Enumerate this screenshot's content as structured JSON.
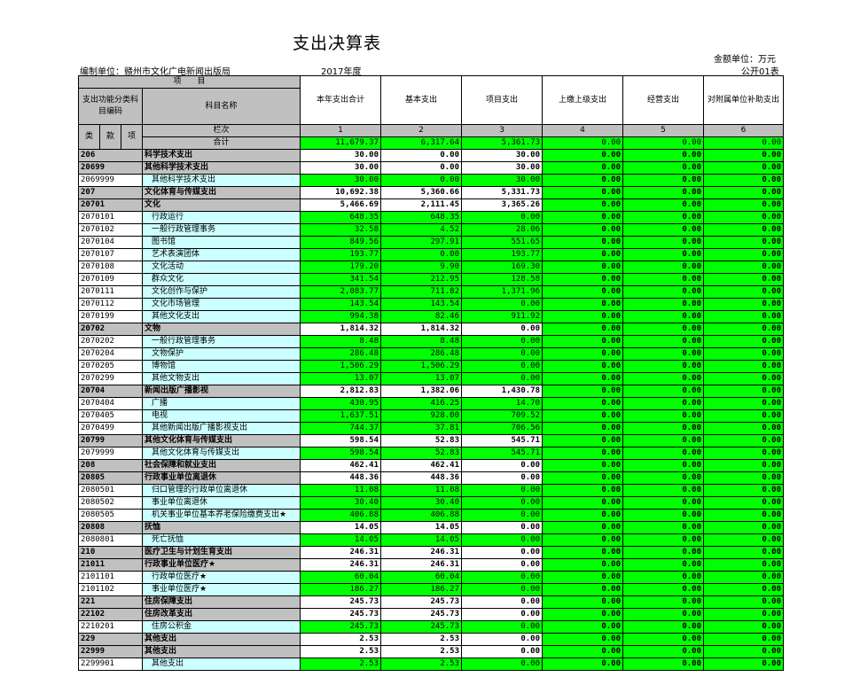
{
  "title": "支出决算表",
  "unit_label": "金额单位：万元",
  "org_label": "编制单位：赣州市文化广电新闻出版局",
  "year_label": "2017年度",
  "form_no": "公开01表",
  "header": {
    "item": "项　　目",
    "code_col": "支出功能分类科目编码",
    "name_col": "科目名称",
    "cols": [
      "本年支出合计",
      "基本支出",
      "项目支出",
      "上缴上级支出",
      "经营支出",
      "对附属单位补助支出"
    ],
    "lei": "类",
    "kuan": "款",
    "xiang": "项",
    "lanci": "栏次",
    "col_nums": [
      "1",
      "2",
      "3",
      "4",
      "5",
      "6"
    ],
    "total_label": "合计",
    "total_values": [
      "11,679.37",
      "6,317.64",
      "5,361.73",
      "0.00",
      "0.00",
      "0.00"
    ]
  },
  "rows": [
    {
      "code": "206",
      "name": "科学技术支出",
      "level": 1,
      "v": [
        "30.00",
        "0.00",
        "30.00",
        "0.00",
        "0.00",
        "0.00"
      ]
    },
    {
      "code": "20699",
      "name": "其他科学技术支出",
      "level": 2,
      "v": [
        "30.00",
        "0.00",
        "30.00",
        "0.00",
        "0.00",
        "0.00"
      ]
    },
    {
      "code": "2069999",
      "name": "其他科学技术支出",
      "level": 3,
      "v": [
        "30.00",
        "0.00",
        "30.00",
        "0.00",
        "0.00",
        "0.00"
      ]
    },
    {
      "code": "207",
      "name": "文化体育与传媒支出",
      "level": 1,
      "v": [
        "10,692.38",
        "5,360.66",
        "5,331.73",
        "0.00",
        "0.00",
        "0.00"
      ]
    },
    {
      "code": "20701",
      "name": "文化",
      "level": 2,
      "v": [
        "5,466.69",
        "2,111.45",
        "3,365.26",
        "0.00",
        "0.00",
        "0.00"
      ]
    },
    {
      "code": "2070101",
      "name": "行政运行",
      "level": 3,
      "v": [
        "648.35",
        "648.35",
        "0.00",
        "0.00",
        "0.00",
        "0.00"
      ]
    },
    {
      "code": "2070102",
      "name": "一般行政管理事务",
      "level": 3,
      "v": [
        "32.58",
        "4.52",
        "28.06",
        "0.00",
        "0.00",
        "0.00"
      ]
    },
    {
      "code": "2070104",
      "name": "图书馆",
      "level": 3,
      "v": [
        "849.56",
        "297.91",
        "551.65",
        "0.00",
        "0.00",
        "0.00"
      ]
    },
    {
      "code": "2070107",
      "name": "艺术表演团体",
      "level": 3,
      "v": [
        "193.77",
        "0.00",
        "193.77",
        "0.00",
        "0.00",
        "0.00"
      ]
    },
    {
      "code": "2070108",
      "name": "文化活动",
      "level": 3,
      "v": [
        "179.20",
        "9.90",
        "169.30",
        "0.00",
        "0.00",
        "0.00"
      ]
    },
    {
      "code": "2070109",
      "name": "群众文化",
      "level": 3,
      "v": [
        "341.54",
        "212.95",
        "128.58",
        "0.00",
        "0.00",
        "0.00"
      ]
    },
    {
      "code": "2070111",
      "name": "文化创作与保护",
      "level": 3,
      "v": [
        "2,083.77",
        "711.82",
        "1,371.96",
        "0.00",
        "0.00",
        "0.00"
      ]
    },
    {
      "code": "2070112",
      "name": "文化市场管理",
      "level": 3,
      "v": [
        "143.54",
        "143.54",
        "0.00",
        "0.00",
        "0.00",
        "0.00"
      ]
    },
    {
      "code": "2070199",
      "name": "其他文化支出",
      "level": 3,
      "v": [
        "994.38",
        "82.46",
        "911.92",
        "0.00",
        "0.00",
        "0.00"
      ]
    },
    {
      "code": "20702",
      "name": "文物",
      "level": 2,
      "v": [
        "1,814.32",
        "1,814.32",
        "0.00",
        "0.00",
        "0.00",
        "0.00"
      ]
    },
    {
      "code": "2070202",
      "name": "一般行政管理事务",
      "level": 3,
      "v": [
        "8.48",
        "8.48",
        "0.00",
        "0.00",
        "0.00",
        "0.00"
      ]
    },
    {
      "code": "2070204",
      "name": "文物保护",
      "level": 3,
      "v": [
        "286.48",
        "286.48",
        "0.00",
        "0.00",
        "0.00",
        "0.00"
      ]
    },
    {
      "code": "2070205",
      "name": "博物馆",
      "level": 3,
      "v": [
        "1,506.29",
        "1,506.29",
        "0.00",
        "0.00",
        "0.00",
        "0.00"
      ]
    },
    {
      "code": "2070299",
      "name": "其他文物支出",
      "level": 3,
      "v": [
        "13.07",
        "13.07",
        "0.00",
        "0.00",
        "0.00",
        "0.00"
      ]
    },
    {
      "code": "20704",
      "name": "新闻出版广播影视",
      "level": 2,
      "v": [
        "2,812.83",
        "1,382.06",
        "1,430.78",
        "0.00",
        "0.00",
        "0.00"
      ]
    },
    {
      "code": "2070404",
      "name": "广播",
      "level": 3,
      "v": [
        "430.95",
        "416.25",
        "14.70",
        "0.00",
        "0.00",
        "0.00"
      ]
    },
    {
      "code": "2070405",
      "name": "电视",
      "level": 3,
      "v": [
        "1,637.51",
        "928.00",
        "709.52",
        "0.00",
        "0.00",
        "0.00"
      ]
    },
    {
      "code": "2070499",
      "name": "其他新闻出版广播影视支出",
      "level": 3,
      "v": [
        "744.37",
        "37.81",
        "706.56",
        "0.00",
        "0.00",
        "0.00"
      ]
    },
    {
      "code": "20799",
      "name": "其他文化体育与传媒支出",
      "level": 2,
      "v": [
        "598.54",
        "52.83",
        "545.71",
        "0.00",
        "0.00",
        "0.00"
      ]
    },
    {
      "code": "2079999",
      "name": "其他文化体育与传媒支出",
      "level": 3,
      "v": [
        "598.54",
        "52.83",
        "545.71",
        "0.00",
        "0.00",
        "0.00"
      ]
    },
    {
      "code": "208",
      "name": "社会保障和就业支出",
      "level": 1,
      "v": [
        "462.41",
        "462.41",
        "0.00",
        "0.00",
        "0.00",
        "0.00"
      ]
    },
    {
      "code": "20805",
      "name": "行政事业单位离退休",
      "level": 2,
      "v": [
        "448.36",
        "448.36",
        "0.00",
        "0.00",
        "0.00",
        "0.00"
      ]
    },
    {
      "code": "2080501",
      "name": "归口管理的行政单位离退休",
      "level": 3,
      "v": [
        "11.08",
        "11.08",
        "0.00",
        "0.00",
        "0.00",
        "0.00"
      ]
    },
    {
      "code": "2080502",
      "name": "事业单位离退休",
      "level": 3,
      "v": [
        "30.40",
        "30.40",
        "0.00",
        "0.00",
        "0.00",
        "0.00"
      ]
    },
    {
      "code": "2080505",
      "name": "机关事业单位基本养老保险缴费支出★",
      "level": 3,
      "v": [
        "406.88",
        "406.88",
        "0.00",
        "0.00",
        "0.00",
        "0.00"
      ]
    },
    {
      "code": "20808",
      "name": "抚恤",
      "level": 2,
      "v": [
        "14.05",
        "14.05",
        "0.00",
        "0.00",
        "0.00",
        "0.00"
      ]
    },
    {
      "code": "2080801",
      "name": "死亡抚恤",
      "level": 3,
      "v": [
        "14.05",
        "14.05",
        "0.00",
        "0.00",
        "0.00",
        "0.00"
      ]
    },
    {
      "code": "210",
      "name": "医疗卫生与计划生育支出",
      "level": 1,
      "v": [
        "246.31",
        "246.31",
        "0.00",
        "0.00",
        "0.00",
        "0.00"
      ]
    },
    {
      "code": "21011",
      "name": "行政事业单位医疗★",
      "level": 2,
      "v": [
        "246.31",
        "246.31",
        "0.00",
        "0.00",
        "0.00",
        "0.00"
      ]
    },
    {
      "code": "2101101",
      "name": "行政单位医疗★",
      "level": 3,
      "v": [
        "60.04",
        "60.04",
        "0.00",
        "0.00",
        "0.00",
        "0.00"
      ]
    },
    {
      "code": "2101102",
      "name": "事业单位医疗★",
      "level": 3,
      "v": [
        "186.27",
        "186.27",
        "0.00",
        "0.00",
        "0.00",
        "0.00"
      ]
    },
    {
      "code": "221",
      "name": "住房保障支出",
      "level": 1,
      "v": [
        "245.73",
        "245.73",
        "0.00",
        "0.00",
        "0.00",
        "0.00"
      ]
    },
    {
      "code": "22102",
      "name": "住房改革支出",
      "level": 2,
      "v": [
        "245.73",
        "245.73",
        "0.00",
        "0.00",
        "0.00",
        "0.00"
      ]
    },
    {
      "code": "2210201",
      "name": "住房公积金",
      "level": 3,
      "v": [
        "245.73",
        "245.73",
        "0.00",
        "0.00",
        "0.00",
        "0.00"
      ]
    },
    {
      "code": "229",
      "name": "其他支出",
      "level": 1,
      "v": [
        "2.53",
        "2.53",
        "0.00",
        "0.00",
        "0.00",
        "0.00"
      ]
    },
    {
      "code": "22999",
      "name": "其他支出",
      "level": 2,
      "v": [
        "2.53",
        "2.53",
        "0.00",
        "0.00",
        "0.00",
        "0.00"
      ]
    },
    {
      "code": "2299901",
      "name": "其他支出",
      "level": 3,
      "v": [
        "2.53",
        "2.53",
        "0.00",
        "0.00",
        "0.00",
        "0.00"
      ]
    }
  ]
}
